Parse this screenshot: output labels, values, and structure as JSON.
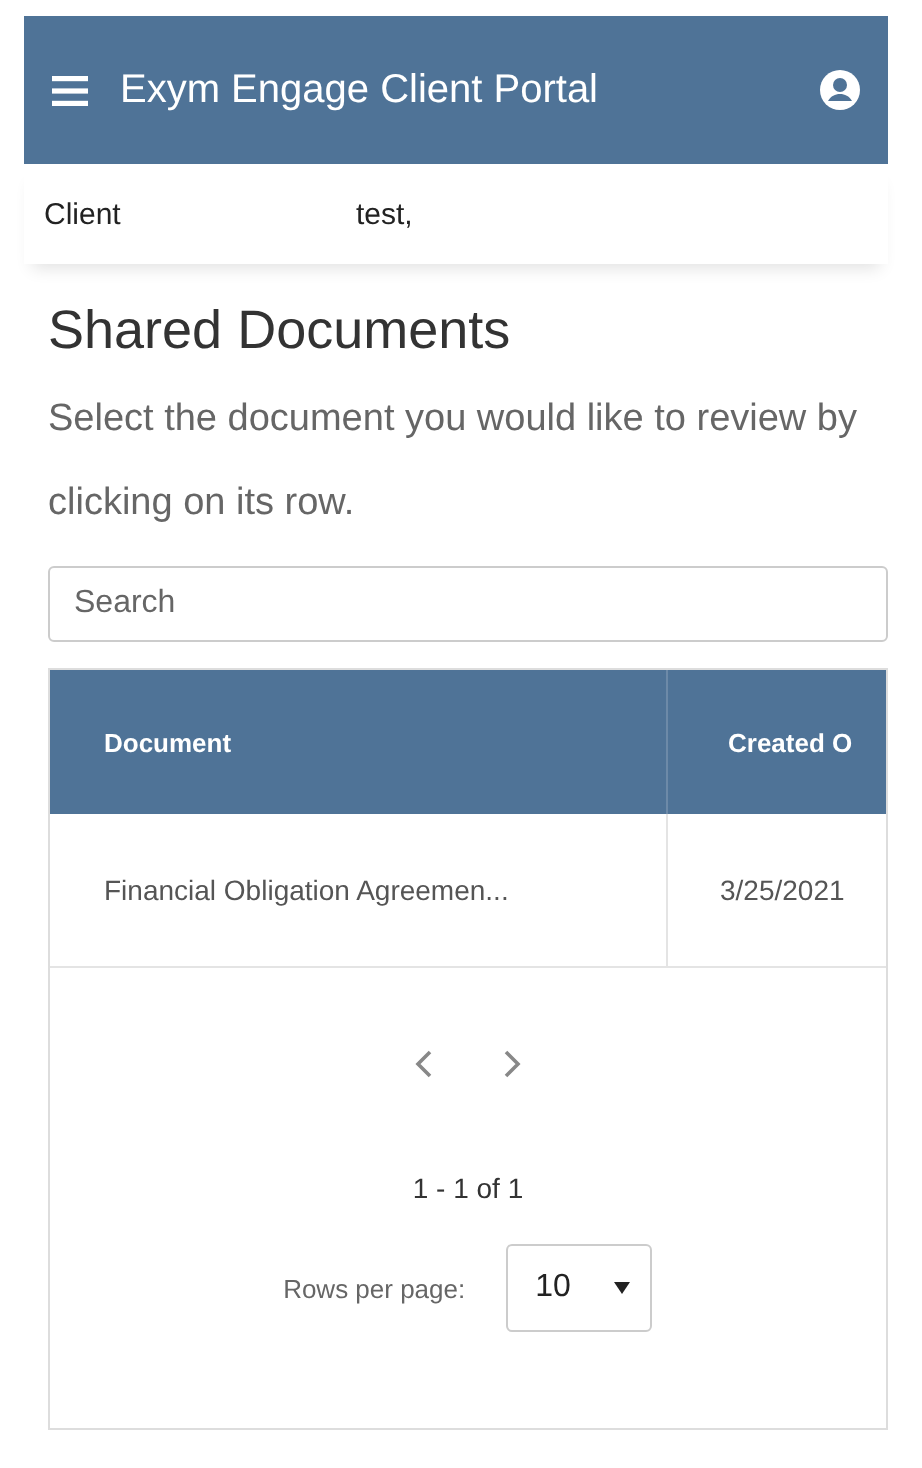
{
  "app_bar": {
    "title": "Exym Engage Client Portal"
  },
  "client_bar": {
    "label": "Client",
    "name": "test,"
  },
  "page": {
    "title": "Shared Documents",
    "description": "Select the document you would like to review by clicking on its row."
  },
  "search": {
    "placeholder": "Search"
  },
  "table": {
    "columns": [
      "Document",
      "Created O"
    ],
    "rows": [
      [
        "Financial Obligation Agreemen...",
        "3/25/2021"
      ]
    ]
  },
  "pagination": {
    "range": "1 - 1 of 1",
    "rows_per_page_label": "Rows per page:",
    "rows_per_page": "10"
  }
}
